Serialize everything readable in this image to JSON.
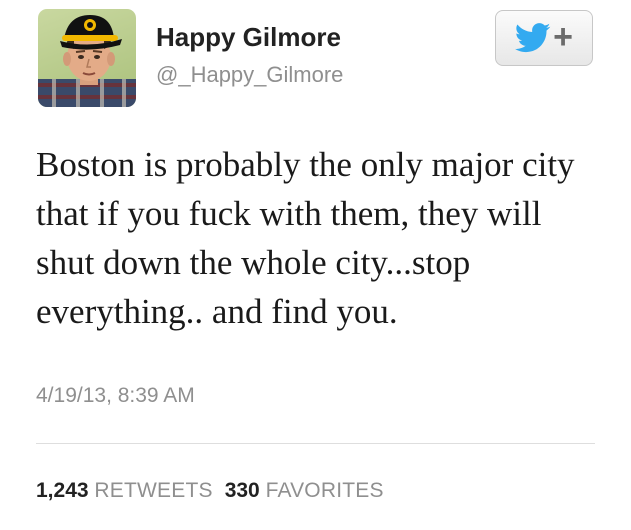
{
  "colors": {
    "twitter_blue": "#33aaf0",
    "name_text": "#222222",
    "secondary_text": "#8f8f8f",
    "divider": "#dedede"
  },
  "profile": {
    "avatar_icon": "user-avatar-photo",
    "display_name": "Happy Gilmore",
    "handle": "@_Happy_Gilmore"
  },
  "follow_button": {
    "icon": "twitter-bird-icon",
    "plus": "+"
  },
  "tweet": {
    "text": "Boston is probably the only major city that if you fuck with them, they will shut down the whole city...stop everything.. and find you.",
    "timestamp": "4/19/13, 8:39 AM"
  },
  "stats": {
    "retweets_count": "1,243",
    "retweets_label": "RETWEETS",
    "favorites_count": "330",
    "favorites_label": "FAVORITES"
  }
}
